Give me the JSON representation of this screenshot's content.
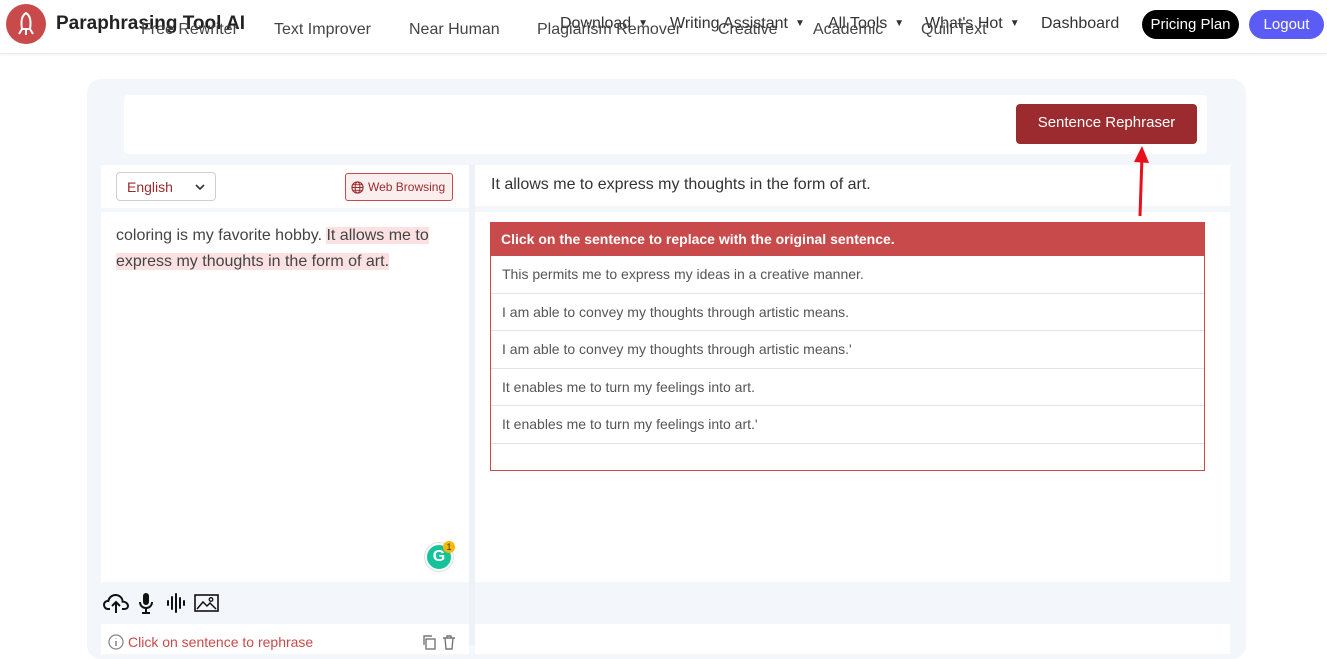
{
  "header": {
    "brand": "Paraphrasing Tool AI",
    "nav": [
      "Download",
      "Writing Assistant",
      "All Tools",
      "What's Hot"
    ],
    "dashboard": "Dashboard",
    "pricing": "Pricing Plan",
    "logout": "Logout"
  },
  "tabs": [
    "Free Rewriter",
    "Text Improver",
    "Near Human",
    "Plagiarism Remover",
    "Creative",
    "Academic",
    "Quill Text"
  ],
  "active_tab": "Sentence Rephraser",
  "left": {
    "language": "English",
    "web_browsing": "Web Browsing",
    "text_plain": "coloring is my favorite hobby. ",
    "text_highlight": "It allows me to express my thoughts in the form of art.",
    "grammarly_letter": "G",
    "grammarly_count": "1",
    "hint": "Click on sentence to rephrase"
  },
  "right": {
    "selected_sentence": "It allows me to express my thoughts in the form of art.",
    "suggestions_header": "Click on the sentence to replace with the original sentence.",
    "suggestions": [
      "This permits me to express my ideas in a creative manner.",
      "I am able to convey my thoughts through artistic means.",
      "I am able to convey my thoughts through artistic means.'",
      "It enables me to turn my feelings into art.",
      "It enables me to turn my feelings into art.'"
    ]
  },
  "colors": {
    "accent": "#9b2b2e",
    "suggest_header": "#c94a4a",
    "logout": "#5b5cf6"
  }
}
